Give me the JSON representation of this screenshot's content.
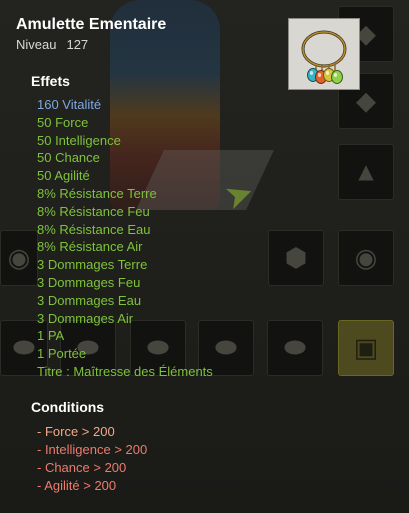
{
  "item": {
    "name": "Amulette Ementaire",
    "level_label": "Niveau",
    "level_value": "127",
    "image_icon": "amulet-icon"
  },
  "effects": {
    "title": "Effets",
    "lines": [
      {
        "text": "160 Vitalité",
        "color": "#7fa9e0"
      },
      {
        "text": "50 Force",
        "color": "#7ec33b"
      },
      {
        "text": "50 Intelligence",
        "color": "#7ec33b"
      },
      {
        "text": "50 Chance",
        "color": "#7ec33b"
      },
      {
        "text": "50 Agilité",
        "color": "#7ec33b"
      },
      {
        "text": "8% Résistance Terre",
        "color": "#7ec33b"
      },
      {
        "text": "8% Résistance Feu",
        "color": "#7ec33b"
      },
      {
        "text": "8% Résistance Eau",
        "color": "#7ec33b"
      },
      {
        "text": "8% Résistance Air",
        "color": "#7ec33b"
      },
      {
        "text": "3 Dommages Terre",
        "color": "#7ec33b"
      },
      {
        "text": "3 Dommages Feu",
        "color": "#7ec33b"
      },
      {
        "text": "3 Dommages Eau",
        "color": "#7ec33b"
      },
      {
        "text": "3 Dommages Air",
        "color": "#7ec33b"
      },
      {
        "text": "1 PA",
        "color": "#7ec33b"
      },
      {
        "text": "1 Portée",
        "color": "#7ec33b"
      },
      {
        "text": "Titre : Maîtresse des Éléments",
        "color": "#7ec33b"
      }
    ]
  },
  "conditions": {
    "title": "Conditions",
    "lines": [
      "- Force > 200",
      "- Intelligence > 200",
      "- Chance > 200",
      "- Agilité > 200"
    ]
  },
  "colors": {
    "effect_green": "#7ec33b",
    "vitality_blue": "#7fa9e0",
    "condition_red": "#ee7b6e"
  }
}
